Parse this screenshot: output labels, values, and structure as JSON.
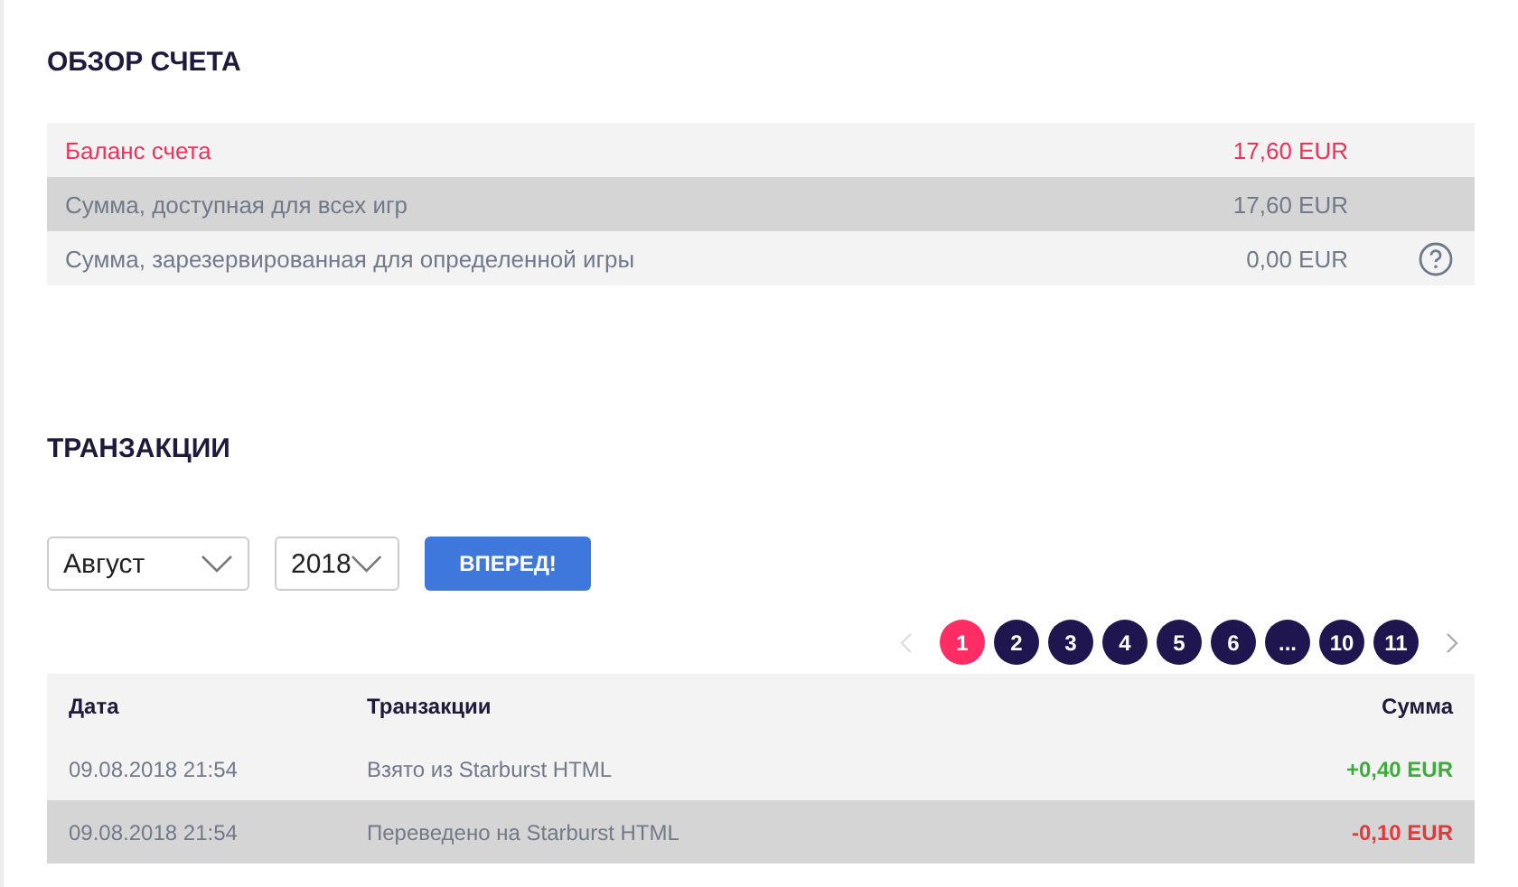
{
  "overview": {
    "title": "ОБЗОР СЧЕТА",
    "rows": [
      {
        "kind": "total",
        "label": "Баланс счета",
        "amount": "17,60 EUR",
        "help": false
      },
      {
        "kind": "plain",
        "label": "Сумма, доступная для всех игр",
        "amount": "17,60 EUR",
        "help": false
      },
      {
        "kind": "plain",
        "label": "Сумма, зарезервированная для определенной игры",
        "amount": "0,00 EUR",
        "help": true
      }
    ]
  },
  "transactions": {
    "title": "ТРАНЗАКЦИИ",
    "filters": {
      "month": "Август",
      "year": "2018",
      "button": "ВПЕРЕД!"
    },
    "pagination": {
      "prev_disabled": true,
      "next_disabled": false,
      "pages": [
        {
          "label": "1",
          "selected": true
        },
        {
          "label": "2",
          "selected": false
        },
        {
          "label": "3",
          "selected": false
        },
        {
          "label": "4",
          "selected": false
        },
        {
          "label": "5",
          "selected": false
        },
        {
          "label": "6",
          "selected": false
        },
        {
          "label": "...",
          "selected": false
        },
        {
          "label": "10",
          "selected": false
        },
        {
          "label": "11",
          "selected": false
        }
      ]
    },
    "table": {
      "columns": [
        "Дата",
        "Транзакции",
        "Сумма"
      ],
      "rows": [
        {
          "date": "09.08.2018 21:54",
          "description": "Взято из Starburst HTML",
          "amount": "+0,40 EUR",
          "kind": "credit"
        },
        {
          "date": "09.08.2018 21:54",
          "description": "Переведено на Starburst HTML",
          "amount": "-0,10 EUR",
          "kind": "debit"
        }
      ]
    }
  }
}
